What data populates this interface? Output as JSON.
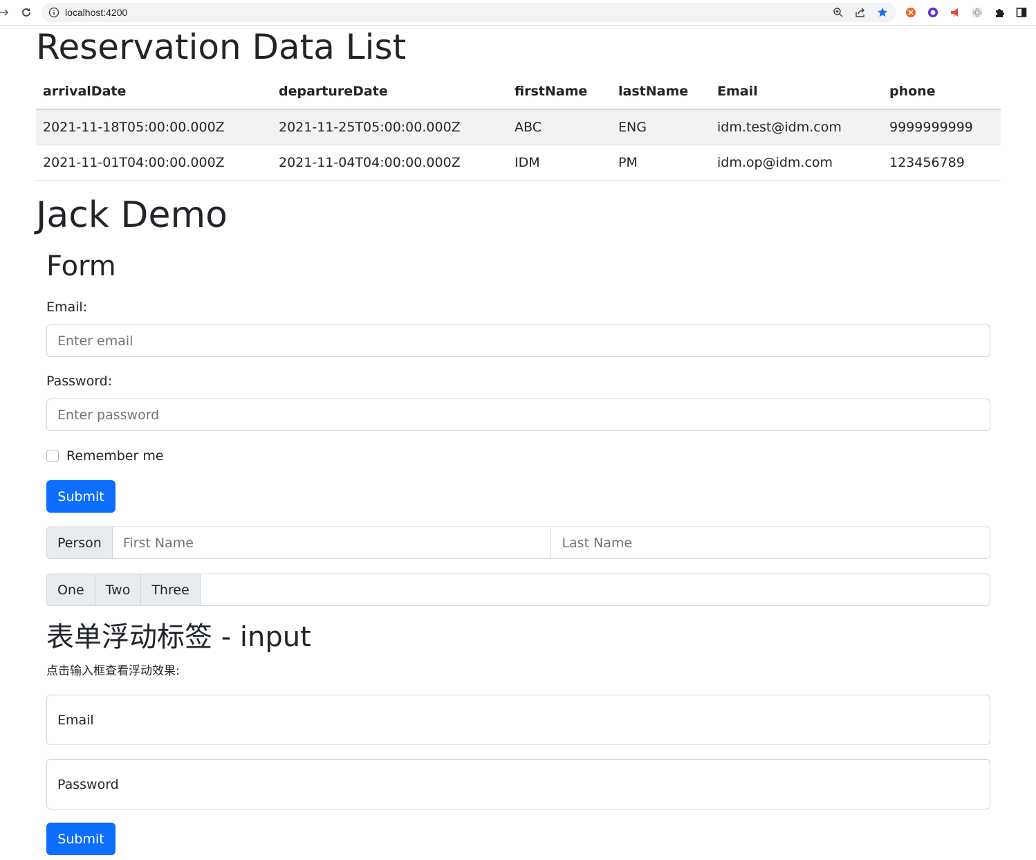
{
  "browser": {
    "url": "localhost:4200"
  },
  "page": {
    "title": "Reservation Data List",
    "table": {
      "headers": [
        "arrivalDate",
        "departureDate",
        "firstName",
        "lastName",
        "Email",
        "phone"
      ],
      "rows": [
        [
          "2021-11-18T05:00:00.000Z",
          "2021-11-25T05:00:00.000Z",
          "ABC",
          "ENG",
          "idm.test@idm.com",
          "9999999999"
        ],
        [
          "2021-11-01T04:00:00.000Z",
          "2021-11-04T04:00:00.000Z",
          "IDM",
          "PM",
          "idm.op@idm.com",
          "123456789"
        ]
      ]
    },
    "demo_heading": "Jack Demo",
    "form": {
      "heading": "Form",
      "email_label": "Email:",
      "email_placeholder": "Enter email",
      "password_label": "Password:",
      "password_placeholder": "Enter password",
      "remember_label": "Remember me",
      "submit_label": "Submit"
    },
    "person_group": {
      "addon": "Person",
      "first_placeholder": "First Name",
      "last_placeholder": "Last Name"
    },
    "number_group": {
      "addons": [
        "One",
        "Two",
        "Three"
      ]
    },
    "floating": {
      "heading": "表单浮动标签 - input",
      "note": "点击输入框查看浮动效果:",
      "email_label": "Email",
      "password_label": "Password",
      "submit_label": "Submit"
    }
  }
}
